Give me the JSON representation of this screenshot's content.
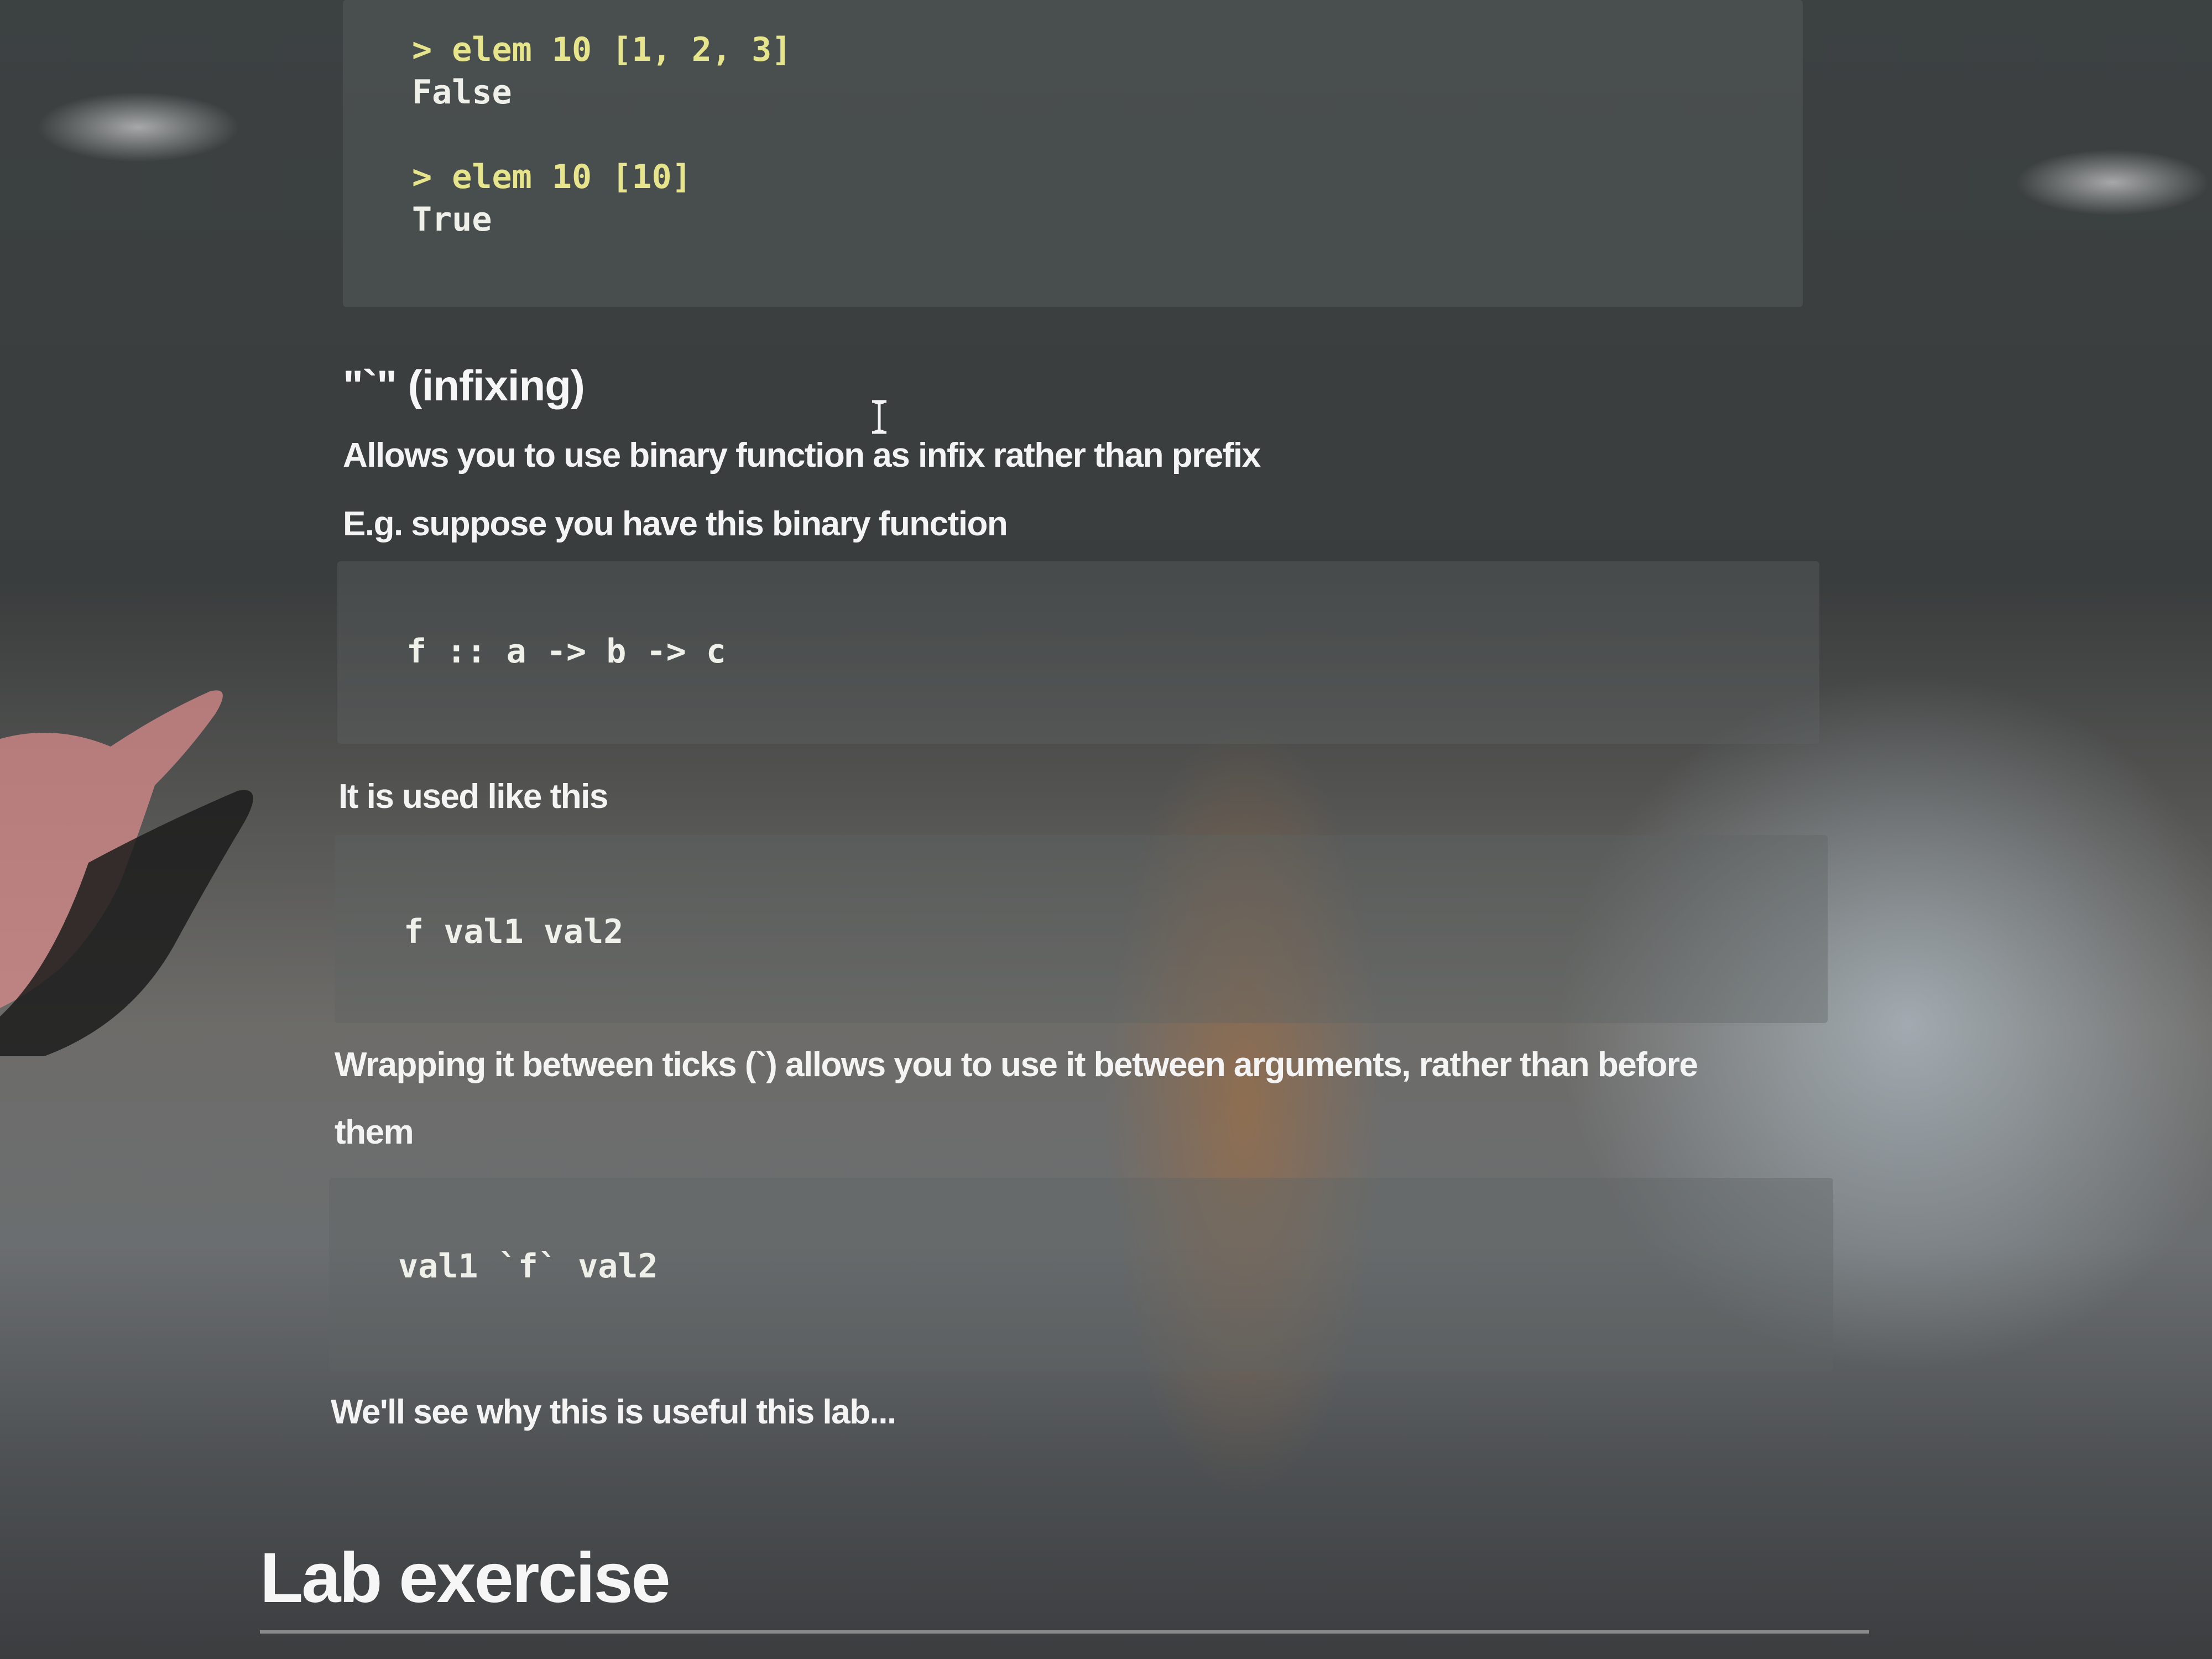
{
  "code_examples": {
    "elem_example": [
      {
        "kind": "prompt",
        "text": "> elem 10 [1, 2, 3]"
      },
      {
        "kind": "result",
        "text": "False"
      },
      {
        "kind": "prompt",
        "text": "> elem 10 [10]"
      },
      {
        "kind": "result",
        "text": "True"
      }
    ],
    "signature": "f :: a -> b -> c",
    "prefix_usage": "f val1 val2",
    "infix_usage": "val1 `f` val2"
  },
  "section_infixing": {
    "heading": "\"`\" (infixing)",
    "intro": "Allows you to use binary function as infix rather than prefix",
    "example_intro": "E.g. suppose you have this binary function",
    "usage_intro": "It is used like this",
    "wrapping_line1": "Wrapping it between ticks (`) allows you to use it between arguments, rather than before",
    "wrapping_line2": "them",
    "closing": "We'll see why this is useful this lab..."
  },
  "next_section": {
    "heading": "Lab exercise"
  },
  "icons": {
    "cursor": "text-cursor-icon"
  },
  "colors": {
    "prompt": "#e6e58c",
    "text": "#f4f4f4",
    "code_bg": "#5f6464"
  }
}
